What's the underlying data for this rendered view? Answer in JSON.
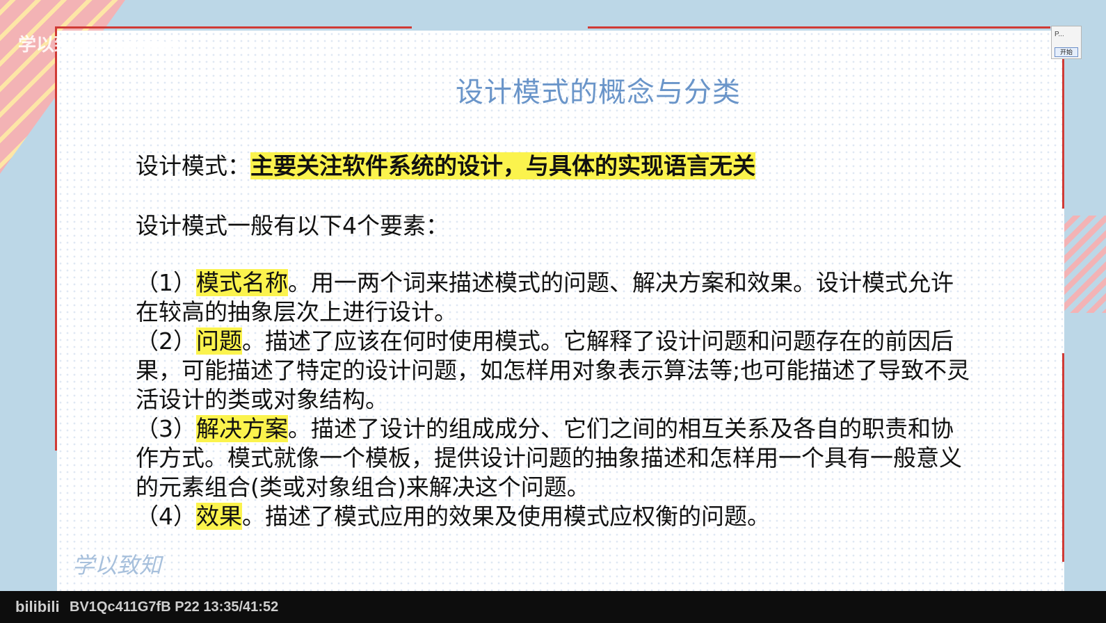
{
  "watermark": "学以致用Learning",
  "slide": {
    "title": "设计模式的概念与分类",
    "definition_prefix": "设计模式：",
    "definition_highlight": "主要关注软件系统的设计，与具体的实现语言无关",
    "elements_intro": "设计模式一般有以下4个要素：",
    "items": [
      {
        "num": "（1）",
        "term": "模式名称",
        "line1": "。用一两个词来描述模式的问题、解决方案和效果。设计模式允许",
        "line2": "在较高的抽象层次上进行设计。",
        "line3": ""
      },
      {
        "num": "（2）",
        "term": "问题",
        "line1": "。描述了应该在何时使用模式。它解释了设计问题和问题存在的前因后",
        "line2": "果，可能描述了特定的设计问题，如怎样用对象表示算法等;也可能描述了导致不灵",
        "line3": "活设计的类或对象结构。"
      },
      {
        "num": "（3）",
        "term": "解决方案",
        "line1": "。描述了设计的组成成分、它们之间的相互关系及各自的职责和协",
        "line2": "作方式。模式就像一个模板，提供设计问题的抽象描述和怎样用一个具有一般意义",
        "line3": "的元素组合(类或对象组合)来解决这个问题。"
      },
      {
        "num": "（4）",
        "term": "效果",
        "line1": "。描述了模式应用的效果及使用模式应权衡的问题。",
        "line2": "",
        "line3": ""
      }
    ],
    "footer_calligraphy": "学以致知"
  },
  "mini_panel": {
    "label": "P...",
    "button": "开始"
  },
  "player": {
    "logo": "bilibili",
    "video_info": "BV1Qc411G7fB P22 13:35/41:52"
  },
  "colors": {
    "highlight": "#fbf34d",
    "title": "#6a95c9",
    "frame": "#d03a35",
    "bar": "#0d0d0d"
  }
}
